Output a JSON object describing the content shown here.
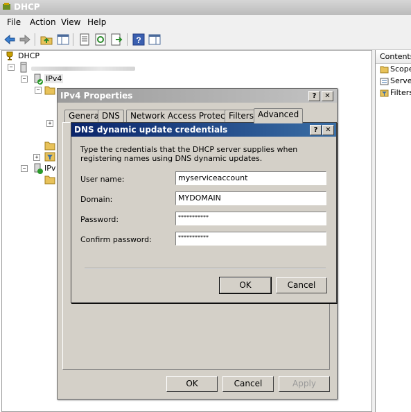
{
  "window": {
    "title": "DHCP"
  },
  "menu": [
    "File",
    "Action",
    "View",
    "Help"
  ],
  "toolbar": {
    "icons": [
      "back-arrow-icon",
      "forward-arrow-icon",
      "up-folder-icon",
      "show-hide-tree-icon",
      "properties-icon",
      "refresh-icon",
      "export-list-icon",
      "help-icon",
      "console-tree-icon"
    ]
  },
  "tree": {
    "root": "DHCP",
    "ipv4": "IPv4",
    "ipv6": "IPv"
  },
  "right_pane": {
    "header": "Contents",
    "items": [
      "Scope",
      "Server",
      "Filters"
    ]
  },
  "props_dialog": {
    "title": "IPv4 Properties",
    "help_glyph": "?",
    "close_glyph": "✕",
    "tabs": [
      "General",
      "DNS",
      "Network Access Protection",
      "Filters",
      "Advanced"
    ],
    "active_tab": "Advanced",
    "buttons": {
      "ok": "OK",
      "cancel": "Cancel",
      "apply": "Apply"
    }
  },
  "cred_dialog": {
    "title": "DNS dynamic update credentials",
    "description": "Type the credentials that the DHCP server supplies when registering names using DNS dynamic updates.",
    "fields": {
      "user_name": {
        "label": "User name:",
        "value": "myserviceaccount"
      },
      "domain": {
        "label": "Domain:",
        "value": "MYDOMAIN"
      },
      "password": {
        "label": "Password:",
        "value": "***********"
      },
      "confirm": {
        "label": "Confirm password:",
        "value": "***********"
      }
    },
    "buttons": {
      "ok": "OK",
      "cancel": "Cancel"
    }
  },
  "colors": {
    "active_title": "#0a246a",
    "inactive_title": "#9b9b9b",
    "dialog_face": "#d4d0c8"
  }
}
